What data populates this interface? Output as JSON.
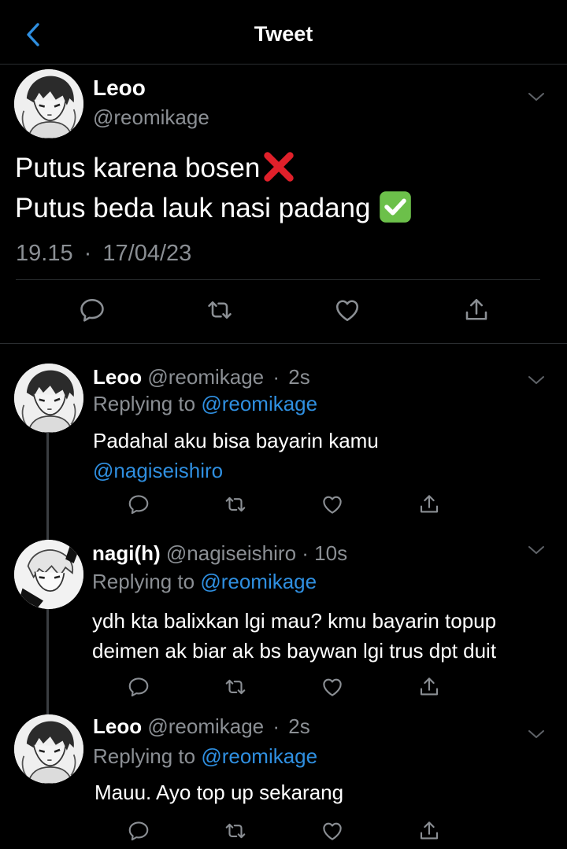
{
  "header": {
    "title": "Tweet"
  },
  "main_tweet": {
    "name": "Leoo",
    "handle": "@reomikage",
    "line1": "Putus karena bosen",
    "line2": "Putus beda lauk nasi padang",
    "time": "19.15",
    "date": "17/04/23",
    "separator": "·"
  },
  "replies": [
    {
      "name": "Leoo",
      "handle": "@reomikage",
      "dot": "·",
      "age": "2s",
      "replying_label": "Replying to",
      "replying_to": "@reomikage",
      "text_line1": "Padahal aku bisa bayarin kamu",
      "mention": "@nagiseishiro"
    },
    {
      "name": "nagi(h)",
      "handle": "@nagiseishiro",
      "dot": "·",
      "age": "10s",
      "replying_label": "Replying to",
      "replying_to": "@reomikage",
      "text_line1": "ydh kta balixkan lgi mau? kmu bayarin topup",
      "text_line2": "deimen ak biar ak bs baywan lgi trus dpt duit"
    },
    {
      "name": "Leoo",
      "handle": "@reomikage",
      "dot": "·",
      "age": "2s",
      "replying_label": "Replying to",
      "replying_to": "@reomikage",
      "text_line1": "Mauu. Ayo top up sekarang"
    }
  ],
  "icons": {
    "back": "chevron-left-icon",
    "reply": "comment-icon",
    "retweet": "retweet-icon",
    "like": "heart-icon",
    "share": "share-icon",
    "wrong": "cross-mark-icon",
    "right": "check-mark-icon"
  },
  "colors": {
    "background": "#000000",
    "link": "#2f8fe0",
    "muted": "#8b8f94",
    "divider": "#2a2d30"
  }
}
